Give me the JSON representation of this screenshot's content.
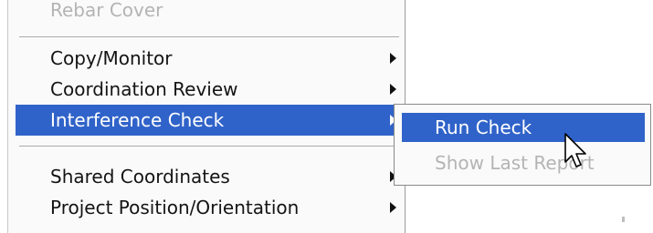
{
  "menu": {
    "items_top": [
      {
        "label": "Rebar Cover",
        "state": "disabled"
      }
    ],
    "items_mid": [
      {
        "label": "Copy/Monitor",
        "submenu": true
      },
      {
        "label": "Coordination Review",
        "submenu": true
      },
      {
        "label": "Interference Check",
        "submenu": true,
        "state": "highlighted"
      }
    ],
    "items_bottom": [
      {
        "label": "Shared Coordinates",
        "submenu": true
      },
      {
        "label": "Project Position/Orientation",
        "submenu": true
      }
    ]
  },
  "submenu": {
    "items": [
      {
        "label": "Run Check",
        "state": "highlighted"
      },
      {
        "label": "Show Last Report",
        "state": "disabled"
      }
    ]
  },
  "colors": {
    "highlight": "#3063c9",
    "menu_background": "#fafafa",
    "disabled_text": "#b4b4b4"
  },
  "icons": [
    "submenu-arrow-icon",
    "mouse-pointer-icon"
  ]
}
